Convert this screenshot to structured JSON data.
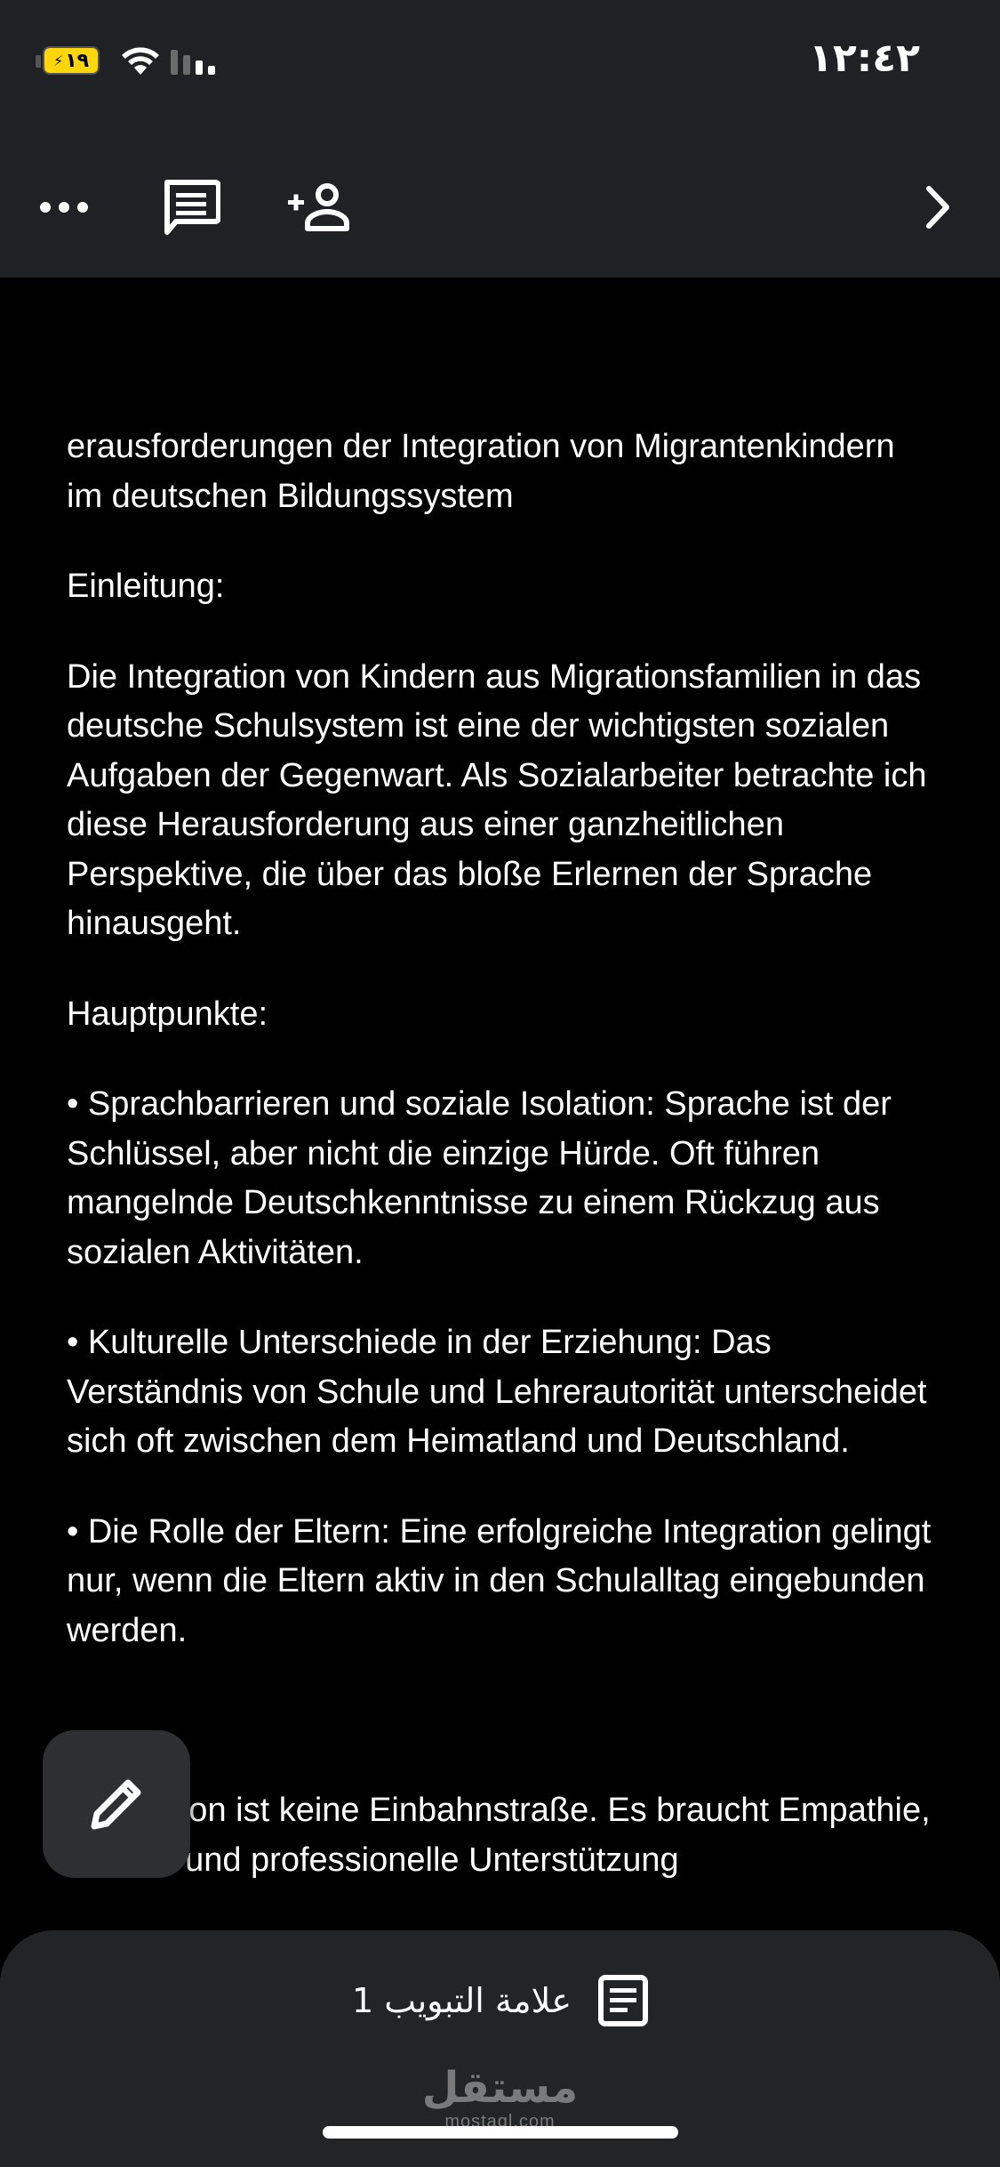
{
  "status_bar": {
    "time": "١٢:٤٢",
    "battery": "١٩"
  },
  "toolbar": {
    "icons": [
      "more-icon",
      "comment-icon",
      "add-person-icon",
      "chevron-right-icon"
    ]
  },
  "document": {
    "paragraphs": [
      "erausforderungen der Integration von Migrantenkindern im deutschen Bildungssystem",
      "Einleitung:",
      "Die Integration von Kindern aus Migrationsfamilien in das deutsche Schulsystem ist eine der wichtigsten sozialen Aufgaben der Gegenwart. Als Sozialarbeiter betrachte ich diese Herausforderung aus einer ganzheitlichen Perspektive, die über das bloße Erlernen der Sprache hinausgeht.",
      "Hauptpunkte:",
      "• Sprachbarrieren und soziale Isolation: Sprache ist der Schlüssel, aber nicht die einzige Hürde. Oft führen mangelnde Deutschkenntnisse zu einem Rückzug aus sozialen Aktivitäten.",
      "• Kulturelle Unterschiede in der Erziehung: Das Verständnis von Schule und Lehrerautorität unterscheidet sich oft zwischen dem Heimatland und Deutschland.",
      "• Die Rolle der Eltern: Eine erfolgreiche Integration gelingt nur, wenn die Eltern aktiv in den Schulalltag eingebunden werden.",
      "",
      "Integration ist keine Einbahnstraße. Es braucht Empathie, Geduld und professionelle Unterstützung"
    ]
  },
  "fab": {
    "icon": "pencil-icon"
  },
  "bottom_sheet": {
    "tab_label": "علامة التبويب 1",
    "watermark_ar": "مستقل",
    "watermark_en": "mostaql.com"
  },
  "colors": {
    "bar_bg": "#202124",
    "doc_bg": "#000000",
    "sheet_bg": "#232426",
    "battery": "#ffd60a"
  }
}
